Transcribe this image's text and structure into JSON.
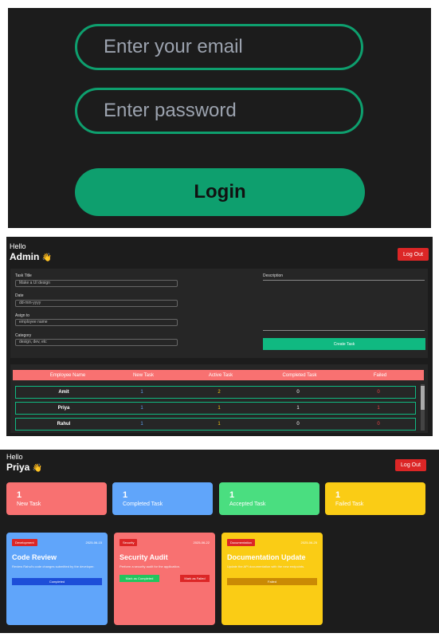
{
  "login": {
    "email_placeholder": "Enter your email",
    "password_placeholder": "Enter password",
    "login_label": "Login"
  },
  "admin": {
    "greeting": "Hello",
    "name": "Admin",
    "wave": "👋",
    "logout_label": "Log Out",
    "form": {
      "task_title_label": "Task Title",
      "task_title_placeholder": "Make a UI design",
      "date_label": "Date",
      "date_placeholder": "dd-mm-yyyy",
      "assign_label": "Asign to",
      "assign_placeholder": "employee name",
      "category_label": "Category",
      "category_placeholder": "design, dev, etc",
      "description_label": "Description",
      "create_label": "Create Task"
    },
    "table": {
      "headers": [
        "Employee Name",
        "New Task",
        "Active Task",
        "Completed Task",
        "Failed"
      ],
      "rows": [
        {
          "name": "Amit",
          "new": "1",
          "active": "2",
          "completed": "0",
          "failed": "0"
        },
        {
          "name": "Priya",
          "new": "1",
          "active": "1",
          "completed": "1",
          "failed": "1"
        },
        {
          "name": "Rahul",
          "new": "1",
          "active": "1",
          "completed": "0",
          "failed": "0"
        }
      ]
    }
  },
  "employee": {
    "greeting": "Hello",
    "name": "Priya",
    "wave": "👋",
    "logout_label": "Log Out",
    "stats": [
      {
        "count": "1",
        "label": "New Task",
        "color": "#f87171"
      },
      {
        "count": "1",
        "label": "Completed Task",
        "color": "#60a5fa"
      },
      {
        "count": "1",
        "label": "Accepted Task",
        "color": "#4ade80"
      },
      {
        "count": "1",
        "label": "Failed Task",
        "color": "#facc15"
      }
    ],
    "cards": [
      {
        "category": "Development",
        "date": "2025-06-15",
        "title": "Code Review",
        "description": "Review Rahul's code changes submitted by the developer.",
        "color": "#60a5fa",
        "status_label": "Completed"
      },
      {
        "category": "Security",
        "date": "2025-06-22",
        "title": "Security Audit",
        "description": "Perform a security audit for the application.",
        "color": "#f87171",
        "complete_label": "Mark as Completed",
        "failed_label": "Mark as Failed"
      },
      {
        "category": "Documentation",
        "date": "2025-06-25",
        "title": "Documentation Update",
        "description": "Update the API documentation with the new endpoints.",
        "color": "#facc15",
        "status_label": "Failed"
      }
    ]
  }
}
